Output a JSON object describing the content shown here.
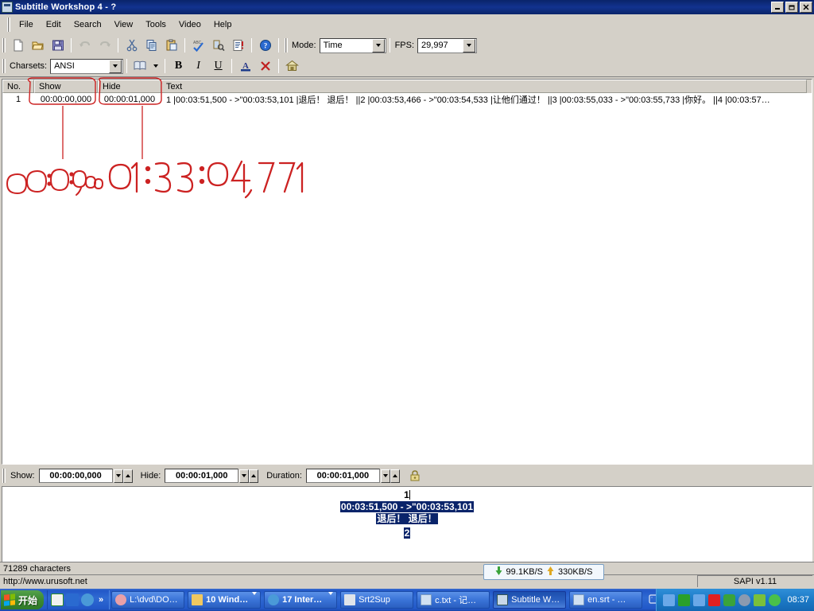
{
  "window": {
    "title": "Subtitle Workshop 4 - ?",
    "icon": "subtitle-workshop-icon",
    "buttons": {
      "minimize": "_",
      "maximize": "❐",
      "close": "✕"
    }
  },
  "menu": {
    "items": [
      "File",
      "Edit",
      "Search",
      "View",
      "Tools",
      "Video",
      "Help"
    ]
  },
  "toolbar1": {
    "icons": [
      "new-file-icon",
      "open-folder-icon",
      "save-icon",
      "undo-icon",
      "redo-icon",
      "cut-icon",
      "copy-icon",
      "paste-icon",
      "spellcheck-icon",
      "search-replace-icon",
      "info-script-icon",
      "help-icon"
    ],
    "mode_label": "Mode:",
    "mode_value": "Time",
    "fps_label": "FPS:",
    "fps_value": "29,997"
  },
  "toolbar2": {
    "charsets_label": "Charsets:",
    "charsets_value": "ANSI",
    "icons": [
      "book-dropdown-icon",
      "bold-icon",
      "italic-icon",
      "underline-icon",
      "font-color-icon",
      "clear-formatting-icon",
      "home-icon"
    ],
    "bold": "B",
    "italic": "I",
    "underline": "U",
    "font_color": "A",
    "clear": "✕"
  },
  "list": {
    "columns": [
      "No.",
      "Show",
      "Hide",
      "Text"
    ],
    "rows": [
      {
        "no": "1",
        "show": "00:00:00,000",
        "hide": "00:00:01,000",
        "text": "1 |00:03:51,500 - >\"00:03:53,101 |退后！ 退后！  ||2 |00:03:53,466 - >\"00:03:54,533 |让他们通过！  ||3 |00:03:55,033 - >\"00:03:55,733 |你好。  ||4 |00:03:57…"
      }
    ]
  },
  "annotation": {
    "color": "#cc2222",
    "handwritten_left": "00:00:00,000",
    "handwritten_right": "01:33:04,771",
    "circled_fields": [
      "Show",
      "Hide"
    ]
  },
  "timepanel": {
    "show_label": "Show:",
    "show_value": "00:00:00,000",
    "hide_label": "Hide:",
    "hide_value": "00:00:01,000",
    "duration_label": "Duration:",
    "duration_value": "00:00:01,000",
    "lock_icon": "padlock-icon"
  },
  "editor": {
    "line_number": "1",
    "selected_line_1": "00:03:51,500 - >\"00:03:53,101",
    "selected_line_2": "退后！ 退后！",
    "line_number_2": "2"
  },
  "status": {
    "characters": "71289 characters",
    "url": "http://www.urusoft.net",
    "sapi": "SAPI v1.11",
    "network": {
      "download": "99.1KB/S",
      "upload": "330KB/S",
      "down_icon": "arrow-down-icon",
      "up_icon": "arrow-up-icon"
    }
  },
  "taskbar": {
    "start_label": "开始",
    "quicklaunch": [
      "media-player-icon",
      "refresh-icon",
      "internet-explorer-icon"
    ],
    "overflow": "»",
    "items": [
      {
        "label": "L:\\dvd\\DO…",
        "icon": "folder-app-icon",
        "has_arrow": false,
        "active": false
      },
      {
        "label": "10 Wind…",
        "icon": "folder-icon",
        "has_arrow": true,
        "active": false
      },
      {
        "label": "17 Inter…",
        "icon": "internet-explorer-icon",
        "has_arrow": true,
        "active": false
      },
      {
        "label": "Srt2Sup",
        "icon": "srt2sup-icon",
        "has_arrow": false,
        "active": false
      },
      {
        "label": "c.txt - 记…",
        "icon": "notepad-icon",
        "has_arrow": false,
        "active": false
      },
      {
        "label": "Subtitle W…",
        "icon": "subtitle-workshop-icon",
        "has_arrow": false,
        "active": true
      },
      {
        "label": "en.srt - …",
        "icon": "notepad-icon",
        "has_arrow": false,
        "active": false
      }
    ],
    "keyboard_icon": "keyboard-icon",
    "tray": [
      "network-icon",
      "media-icon",
      "network2-icon",
      "antivirus-icon",
      "shield-icon",
      "disc-icon",
      "sync-icon",
      "update-icon"
    ],
    "clock": "08:37"
  }
}
